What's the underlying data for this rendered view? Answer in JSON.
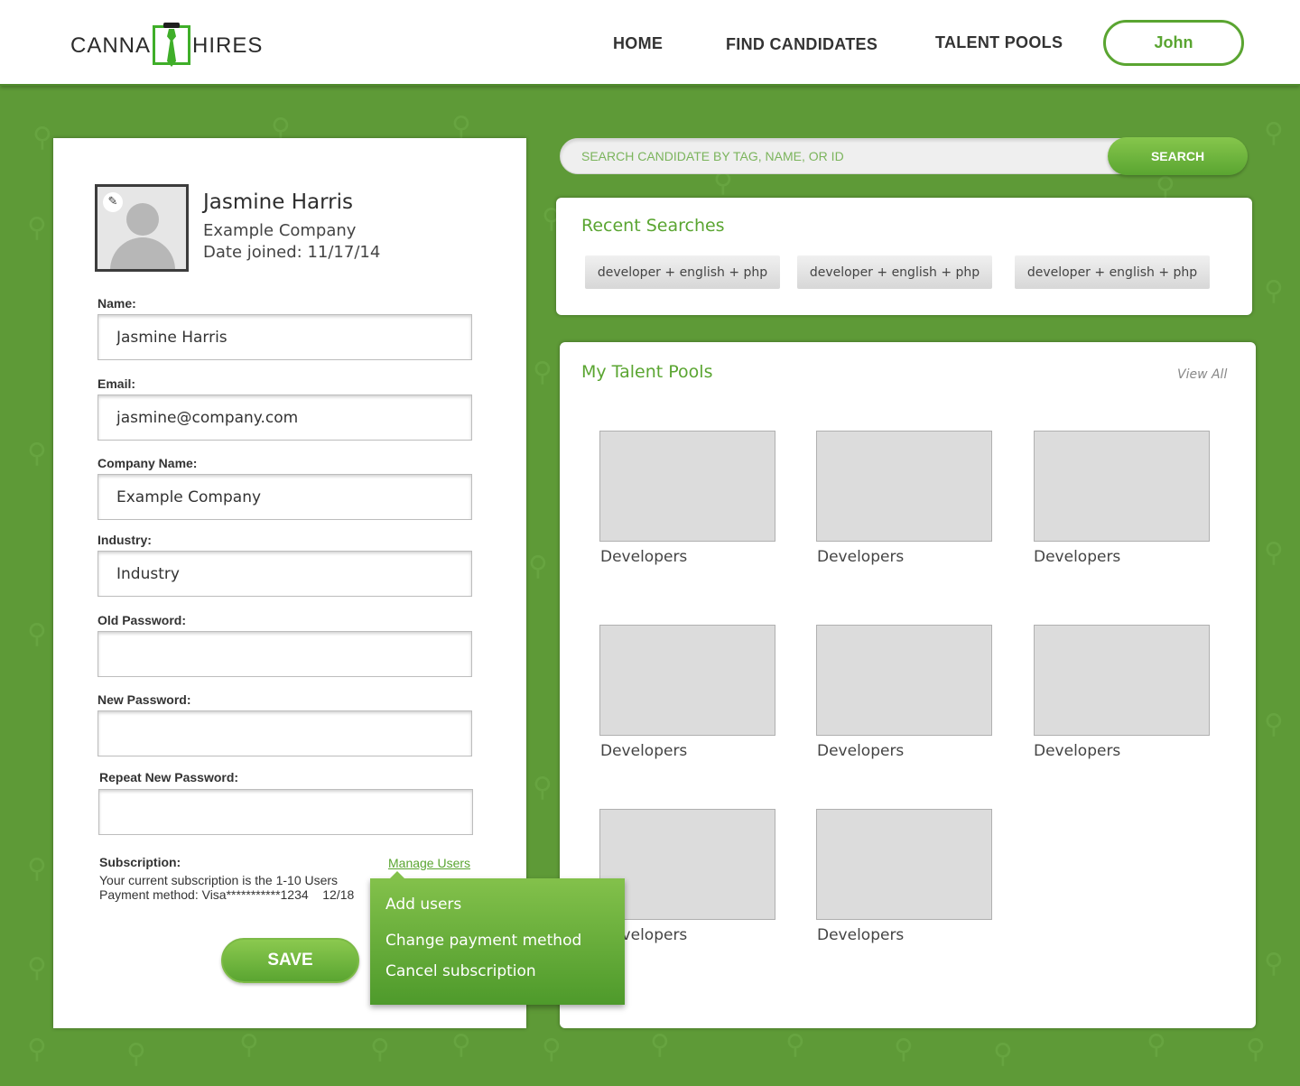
{
  "brand": {
    "left": "CANNA",
    "right": "HIRES",
    "accent": "#5aa531"
  },
  "nav": {
    "home": "HOME",
    "find": "FIND CANDIDATES",
    "pools": "TALENT POOLS",
    "user": "John"
  },
  "profile": {
    "name": "Jasmine Harris",
    "company": "Example Company",
    "joined": "Date joined: 11/17/14",
    "edit_icon": "pencil-icon"
  },
  "form": {
    "name_label": "Name:",
    "name_value": "Jasmine Harris",
    "email_label": "Email:",
    "email_value": "jasmine@company.com",
    "company_label": "Company Name:",
    "company_value": "Example Company",
    "industry_label": "Industry:",
    "industry_value": "Industry",
    "old_pw_label": "Old Password:",
    "new_pw_label": "New Password:",
    "repeat_pw_label": "Repeat New Password:"
  },
  "subscription": {
    "label": "Subscription:",
    "line1": "Your current subscription is the 1-10 Users",
    "line2": "Payment method: Visa***********1234    12/18",
    "manage": "Manage Users"
  },
  "save": "SAVE",
  "dropdown": {
    "items": [
      "Add users",
      "Change payment method",
      "Cancel subscription"
    ]
  },
  "search": {
    "placeholder": "SEARCH CANDIDATE BY TAG, NAME, OR ID",
    "button": "SEARCH"
  },
  "recent": {
    "title": "Recent Searches",
    "chips": [
      "developer + english + php",
      "developer + english + php",
      "developer + english + php"
    ]
  },
  "talent_pools": {
    "title": "My Talent Pools",
    "view_all": "View All",
    "tiles": [
      "Developers",
      "Developers",
      "Developers",
      "Developers",
      "Developers",
      "Developers",
      "Developers",
      "Developers"
    ]
  }
}
